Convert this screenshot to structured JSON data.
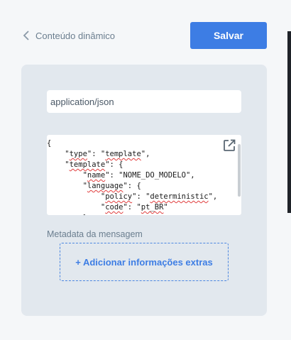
{
  "header": {
    "back_label": "Conteúdo dinâmico",
    "save_label": "Salvar"
  },
  "form": {
    "content_type_value": "application/json",
    "code_lines": [
      "{",
      "    \"type\": \"template\",",
      "    \"template\": {",
      "        \"name\": \"NOME_DO_MODELO\",",
      "        \"language\": {",
      "            \"policy\": \"deterministic\",",
      "            \"code\": \"pt_BR\"",
      "        },"
    ],
    "metadata_label": "Metadata da mensagem",
    "add_extra_label": "+ Adicionar informações extras"
  },
  "colors": {
    "accent": "#3d7de4",
    "panel_bg": "#e2e8ee",
    "muted_text": "#6b7e8f"
  },
  "icons": {
    "back": "chevron-left-icon",
    "expand": "external-link-icon"
  }
}
